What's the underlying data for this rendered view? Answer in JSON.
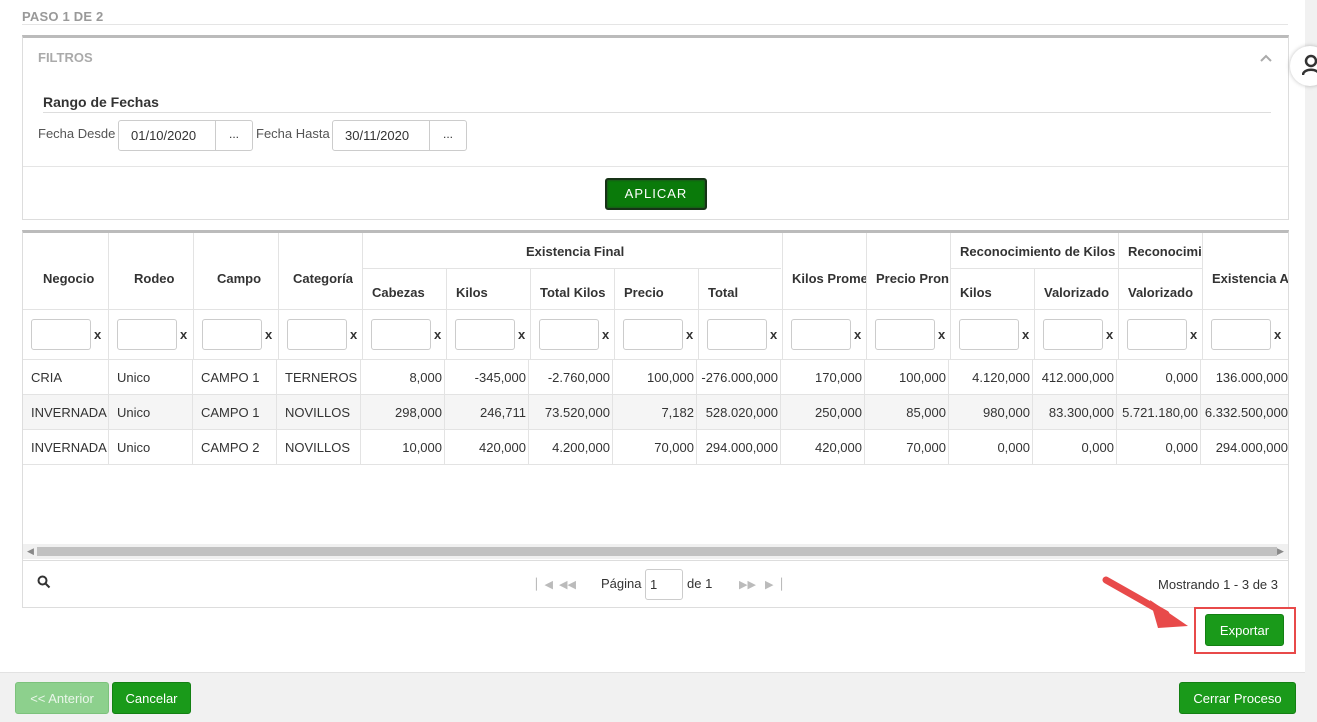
{
  "step": {
    "title": "PASO 1 DE 2"
  },
  "filters": {
    "title": "FILTROS",
    "range_title": "Rango de Fechas",
    "from_label": "Fecha Desde",
    "from_value": "01/10/2020",
    "to_label": "Fecha Hasta",
    "to_value": "30/11/2020",
    "picker_label": "...",
    "apply_label": "APLICAR"
  },
  "grid": {
    "headers": {
      "negocio": "Negocio",
      "rodeo": "Rodeo",
      "campo": "Campo",
      "categoria": "Categoría",
      "existencia_final": "Existencia Final",
      "cabezas": "Cabezas",
      "kilos": "Kilos",
      "total_kilos": "Total Kilos",
      "precio": "Precio",
      "total": "Total",
      "kilos_prom": "Kilos Prome",
      "precio_prom": "Precio Pron",
      "reconocimiento_kilos": "Reconocimiento de Kilos",
      "rk_kilos": "Kilos",
      "rk_valorizado": "Valorizado",
      "reconocimiento2": "Reconocimi",
      "r2_valorizado": "Valorizado",
      "existencia_a": "Existencia A"
    },
    "filter_clear": "x",
    "rows": [
      [
        "CRIA",
        "Unico",
        "CAMPO 1",
        "TERNEROS M",
        "8,000",
        "-345,000",
        "-2.760,000",
        "100,000",
        "-276.000,000",
        "170,000",
        "100,000",
        "4.120,000",
        "412.000,000",
        "0,000",
        "136.000,000"
      ],
      [
        "INVERNADA",
        "Unico",
        "CAMPO 1",
        "NOVILLOS",
        "298,000",
        "246,711",
        "73.520,000",
        "7,182",
        "528.020,000",
        "250,000",
        "85,000",
        "980,000",
        "83.300,000",
        "5.721.180,00",
        "6.332.500,000"
      ],
      [
        "INVERNADA",
        "Unico",
        "CAMPO 2",
        "NOVILLOS",
        "10,000",
        "420,000",
        "4.200,000",
        "70,000",
        "294.000,000",
        "420,000",
        "70,000",
        "0,000",
        "0,000",
        "0,000",
        "294.000,000"
      ]
    ]
  },
  "pager": {
    "page_label": "Página",
    "page_value": "1",
    "of_label": "de 1",
    "status": "Mostrando 1 - 3 de 3"
  },
  "buttons": {
    "export": "Exportar",
    "prev": "<< Anterior",
    "cancel": "Cancelar",
    "close": "Cerrar Proceso"
  },
  "colors": {
    "accent_green": "#1a9a1a",
    "apply_green": "#0a7a0a",
    "highlight_red": "#e84a4a"
  }
}
